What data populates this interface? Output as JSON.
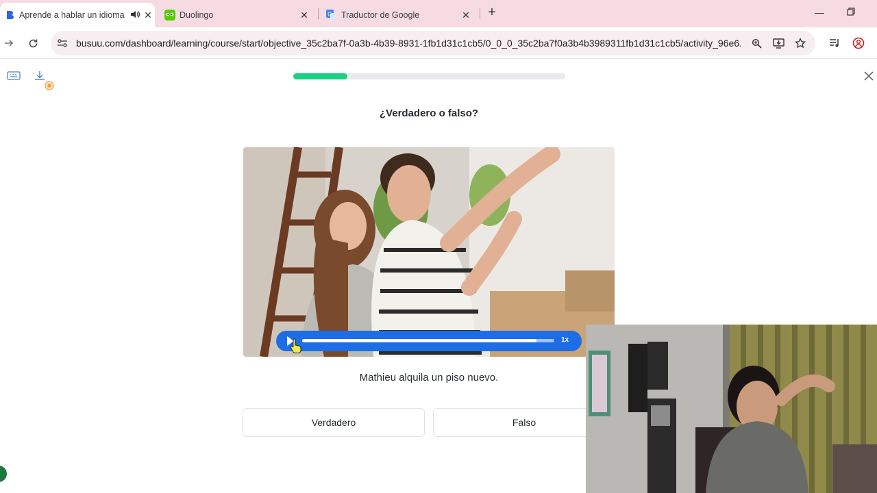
{
  "browser": {
    "tabs": [
      {
        "title": "Aprende a hablar un idioma",
        "active": true,
        "audio": true
      },
      {
        "title": "Duolingo",
        "active": false
      },
      {
        "title": "Traductor de Google",
        "active": false
      }
    ],
    "url": "busuu.com/dashboard/learning/course/start/objective_35c2ba7f-0a3b-4b39-8931-1fb1d31c1cb5/0_0_0_35c2ba7f0a3b4b3989311fb1d31c1cb5/activity_96e6..."
  },
  "lesson": {
    "progress": 0.2,
    "question": "¿Verdadero o falso?",
    "audio": {
      "speed_label": "1x",
      "position": 0.93
    },
    "statement": "Mathieu alquila un piso nuevo.",
    "answers": [
      "Verdadero",
      "Falso"
    ]
  },
  "colors": {
    "progress_fill": "#1ad183",
    "audio_bar": "#1d6de6",
    "tabbar_bg": "#f7dbe3"
  }
}
